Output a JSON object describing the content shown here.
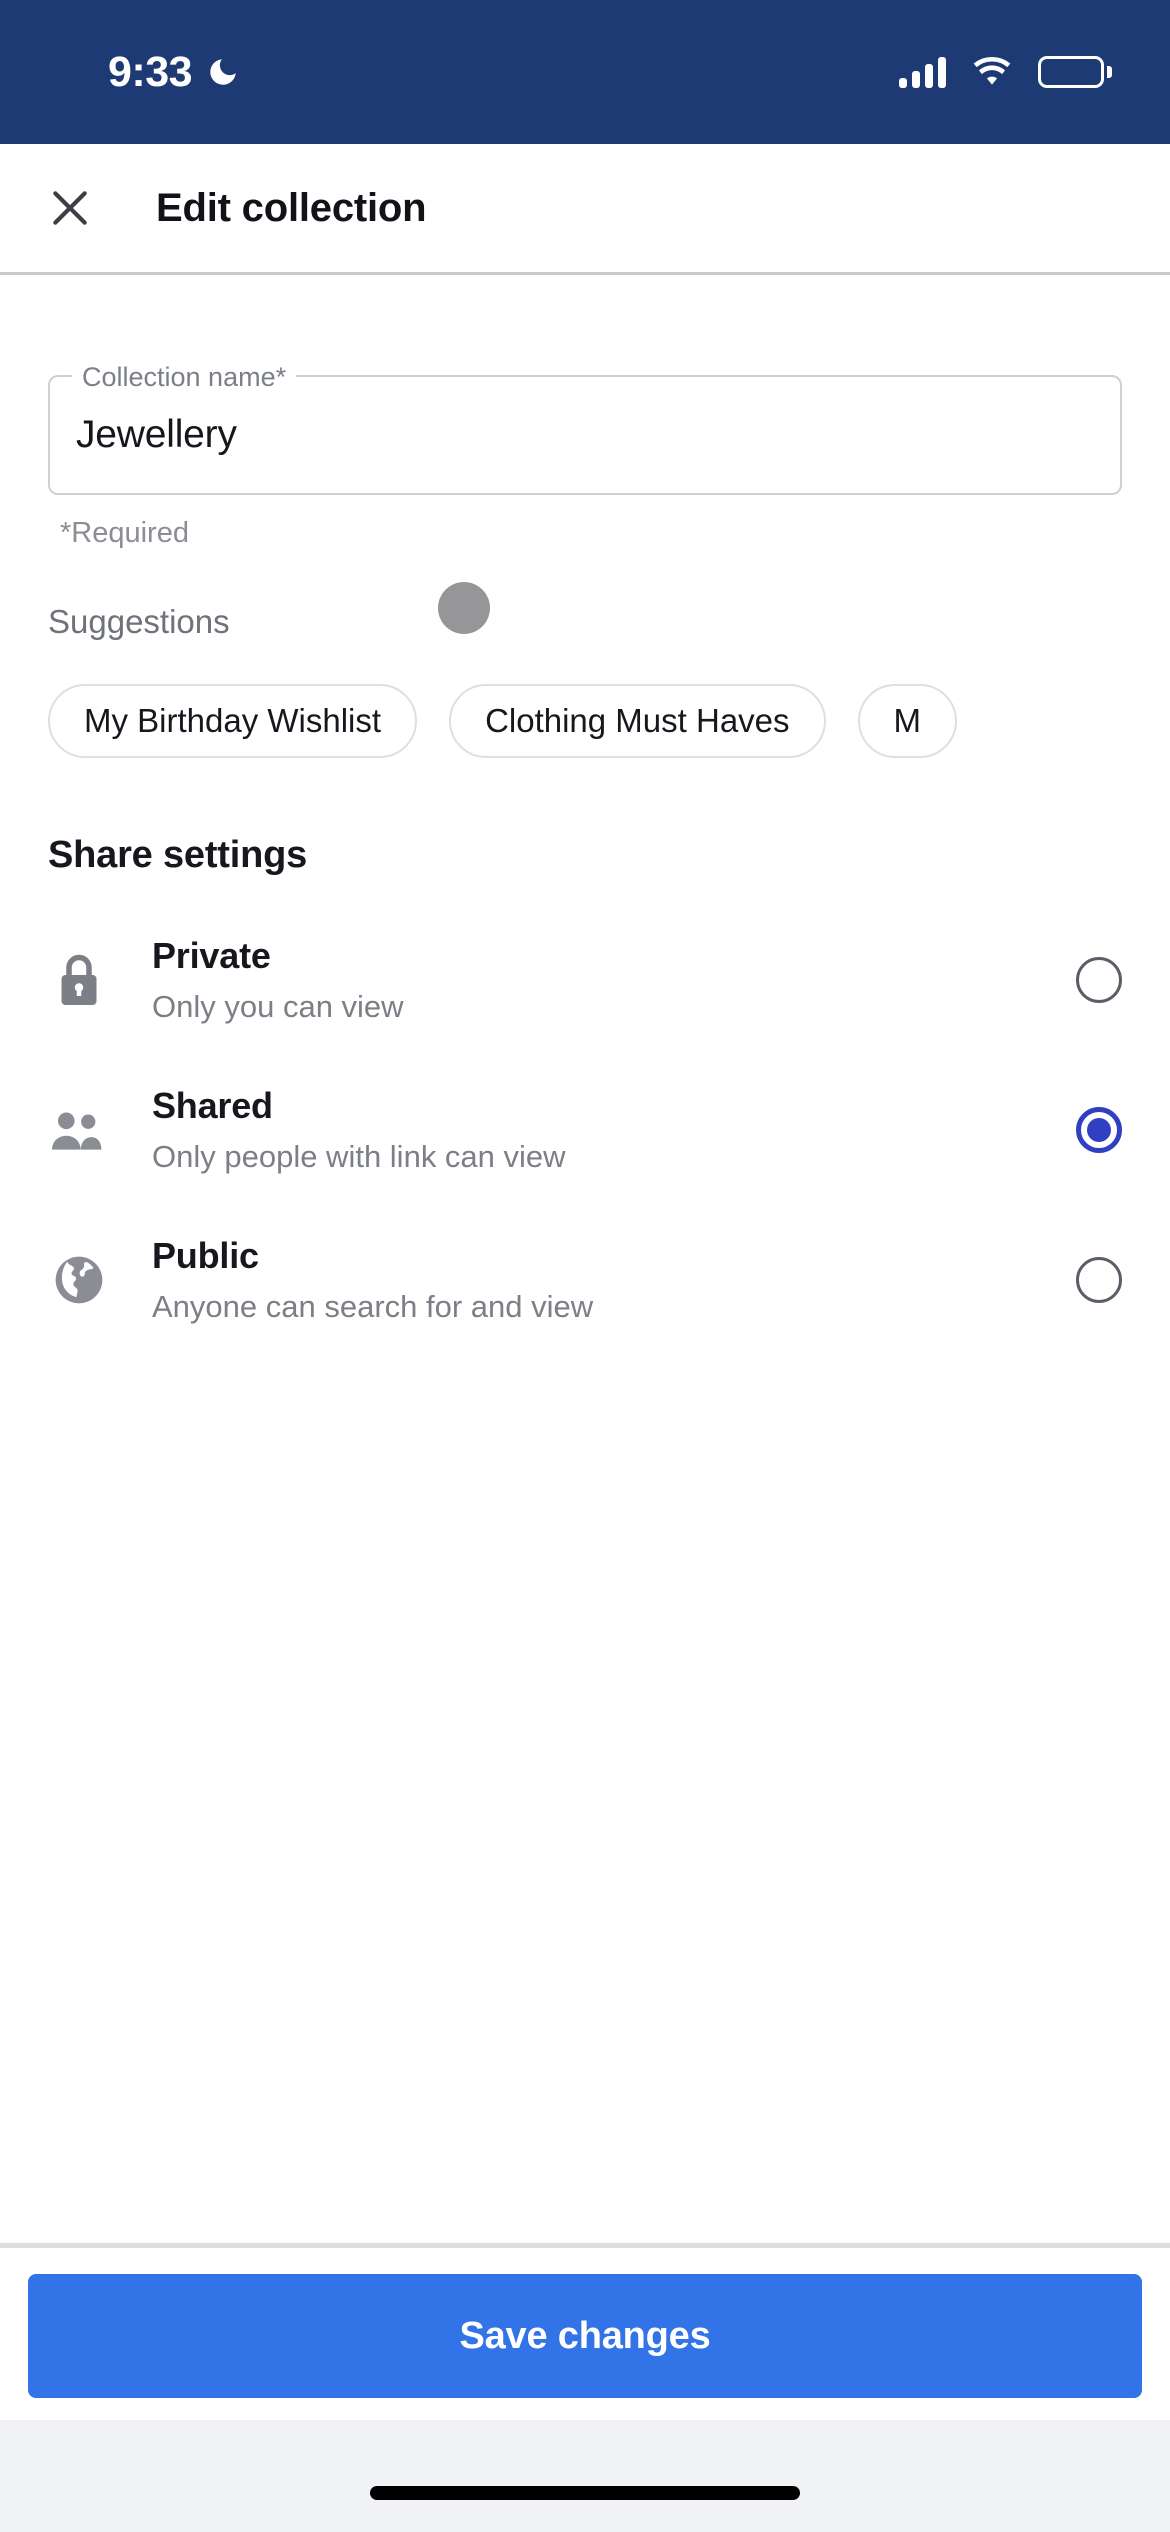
{
  "status_bar": {
    "time": "9:33",
    "moon_icon": "crescent-moon-icon",
    "signal_icon": "cellular-signal-icon",
    "signal_bars": 4,
    "wifi_icon": "wifi-icon",
    "battery_icon": "battery-full-icon",
    "background_color": "#1d3a74",
    "foreground_color": "#ffffff"
  },
  "header": {
    "close_icon": "close-icon",
    "title": "Edit collection"
  },
  "form": {
    "collection_name": {
      "label": "Collection name*",
      "value": "Jewellery",
      "placeholder": "Collection name*"
    },
    "helper_text": "*Required"
  },
  "suggestions": {
    "label": "Suggestions",
    "touch_indicator": "touch-point-indicator",
    "touch_indicator_color": "#969699",
    "chips": [
      {
        "label": "My Birthday Wishlist"
      },
      {
        "label": "Clothing Must Haves"
      },
      {
        "label": "M"
      }
    ]
  },
  "share_settings": {
    "title": "Share settings",
    "selected": "Shared",
    "selected_color": "#3040c0",
    "options": [
      {
        "icon": "lock-icon",
        "title": "Private",
        "subtitle": "Only you can view",
        "selected": false
      },
      {
        "icon": "people-icon",
        "title": "Shared",
        "subtitle": "Only people with link can view",
        "selected": true
      },
      {
        "icon": "globe-icon",
        "title": "Public",
        "subtitle": "Anyone can search for and view",
        "selected": false
      }
    ]
  },
  "footer": {
    "save_label": "Save changes",
    "save_color": "#3274e8",
    "home_indicator": "home-indicator"
  }
}
